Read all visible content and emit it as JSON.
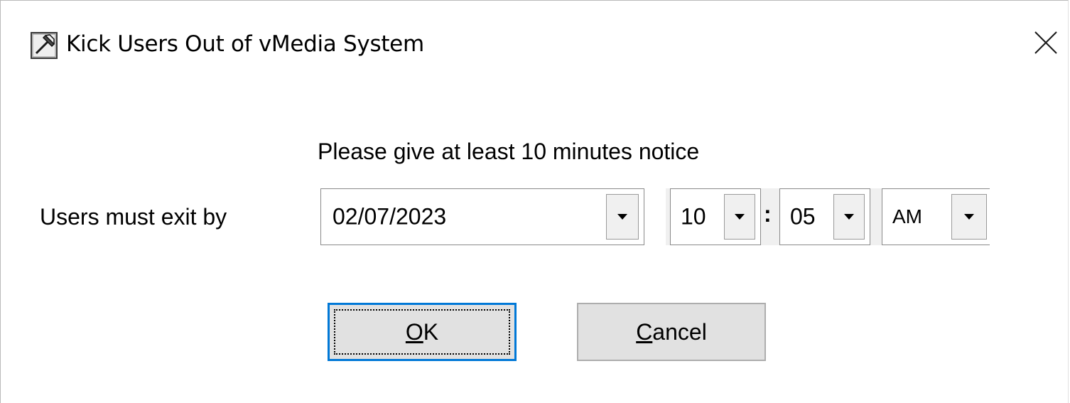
{
  "window": {
    "title": "Kick Users Out of vMedia System",
    "app_icon": "hammer-icon",
    "close_icon": "close-icon"
  },
  "form": {
    "notice": "Please give at least 10 minutes notice",
    "exit_label": "Users must exit by",
    "date": {
      "value": "02/07/2023",
      "icon": "chevron-down-icon"
    },
    "hour": {
      "value": "10",
      "icon": "chevron-down-icon"
    },
    "separator": ":",
    "minute": {
      "value": "05",
      "icon": "chevron-down-icon"
    },
    "ampm": {
      "value": "AM",
      "icon": "chevron-down-icon"
    }
  },
  "buttons": {
    "ok": {
      "mnemonic": "O",
      "rest": "K"
    },
    "cancel": {
      "mnemonic": "C",
      "rest": "ancel"
    }
  },
  "colors": {
    "focus_border": "#0078d7",
    "button_face": "#e1e1e1"
  }
}
